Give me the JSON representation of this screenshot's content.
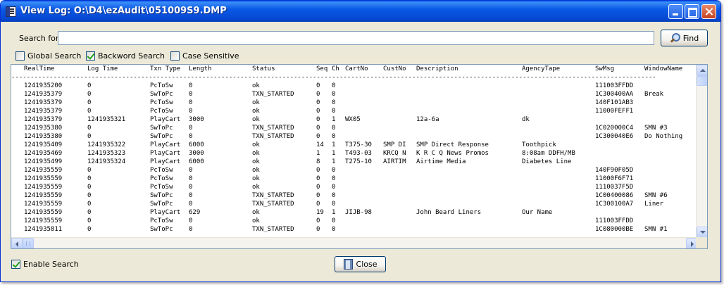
{
  "window": {
    "title": "View Log: O:\\D4\\ezAudit\\051009S9.DMP"
  },
  "search": {
    "label": "Search for:",
    "value": "",
    "find_label": "Find"
  },
  "options": {
    "global_search": {
      "label": "Global Search",
      "checked": false
    },
    "backword_search": {
      "label": "Backword Search",
      "checked": true
    },
    "case_sensitive": {
      "label": "Case Sensitive",
      "checked": false
    }
  },
  "log": {
    "columns": [
      "RealTime",
      "Log Time",
      "Txn Type",
      "Length",
      "Status",
      "Seq",
      "Ch",
      "CartNo",
      "CustNo",
      "Description",
      "AgencyTape",
      "SwMsg",
      "WindowName"
    ],
    "divider": "-------------------------------------------------------------------------------------------------------------------------------------------------------------------------",
    "rows": [
      [
        "1241935200",
        "0",
        "PcToSw",
        "0",
        "ok",
        "0",
        "0",
        "",
        "",
        "",
        "",
        "111003FFDD",
        ""
      ],
      [
        "1241935379",
        "0",
        "SwToPc",
        "0",
        "TXN_STARTED",
        "0",
        "0",
        "",
        "",
        "",
        "",
        "1C300400AA",
        "Break"
      ],
      [
        "1241935379",
        "0",
        "PcToSw",
        "0",
        "ok",
        "0",
        "0",
        "",
        "",
        "",
        "",
        "140F101AB3",
        ""
      ],
      [
        "1241935379",
        "0",
        "PcToSw",
        "0",
        "ok",
        "0",
        "0",
        "",
        "",
        "",
        "",
        "11000FEFF1",
        ""
      ],
      [
        "1241935379",
        "1241935321",
        "PlayCart",
        "3000",
        "ok",
        "0",
        "1",
        "WX05",
        "",
        "12a-6a",
        "dk",
        "",
        ""
      ],
      [
        "1241935380",
        "0",
        "SwToPc",
        "0",
        "TXN_STARTED",
        "0",
        "0",
        "",
        "",
        "",
        "",
        "1C020000C4",
        "SMN #3"
      ],
      [
        "1241935380",
        "0",
        "SwToPc",
        "0",
        "TXN_STARTED",
        "0",
        "0",
        "",
        "",
        "",
        "",
        "1C300040E6",
        "Do Nothing"
      ],
      [
        "1241935409",
        "1241935322",
        "PlayCart",
        "6000",
        "ok",
        "14",
        "1",
        "T375-30",
        "SMP DI",
        "SMP Direct Response",
        "Toothpick",
        "",
        ""
      ],
      [
        "1241935469",
        "1241935323",
        "PlayCart",
        "3000",
        "ok",
        "1",
        "1",
        "T493-03",
        "KRCQ N",
        "K R C Q News Promos",
        "8:08am DDFH/MB",
        "",
        ""
      ],
      [
        "1241935499",
        "1241935324",
        "PlayCart",
        "6000",
        "ok",
        "8",
        "1",
        "T275-10",
        "AIRTIM",
        "Airtime Media",
        "Diabetes Line",
        "",
        ""
      ],
      [
        "1241935559",
        "0",
        "PcToSw",
        "0",
        "ok",
        "0",
        "0",
        "",
        "",
        "",
        "",
        "140F90F05D",
        ""
      ],
      [
        "1241935559",
        "0",
        "PcToSw",
        "0",
        "ok",
        "0",
        "0",
        "",
        "",
        "",
        "",
        "11000F6F71",
        ""
      ],
      [
        "1241935559",
        "0",
        "PcToSw",
        "0",
        "ok",
        "0",
        "0",
        "",
        "",
        "",
        "",
        "1110037F5D",
        ""
      ],
      [
        "1241935559",
        "0",
        "SwToPc",
        "0",
        "TXN_STARTED",
        "0",
        "0",
        "",
        "",
        "",
        "",
        "1C00400086",
        "SMN #6"
      ],
      [
        "1241935559",
        "0",
        "SwToPc",
        "0",
        "TXN_STARTED",
        "0",
        "0",
        "",
        "",
        "",
        "",
        "1C300100A7",
        "Liner"
      ],
      [
        "1241935559",
        "0",
        "PlayCart",
        "629",
        "ok",
        "19",
        "1",
        "JIJB-98",
        "",
        "John Beard Liners",
        "Our Name",
        "",
        ""
      ],
      [
        "1241935559",
        "0",
        "PcToSw",
        "0",
        "ok",
        "0",
        "0",
        "",
        "",
        "",
        "",
        "111003FFDD",
        ""
      ],
      [
        "1241935811",
        "0",
        "SwToPc",
        "0",
        "TXN_STARTED",
        "0",
        "0",
        "",
        "",
        "",
        "",
        "1C080000BE",
        "SMN #1"
      ]
    ]
  },
  "footer": {
    "enable_search": {
      "label": "Enable Search",
      "checked": true
    },
    "close_label": "Close"
  }
}
